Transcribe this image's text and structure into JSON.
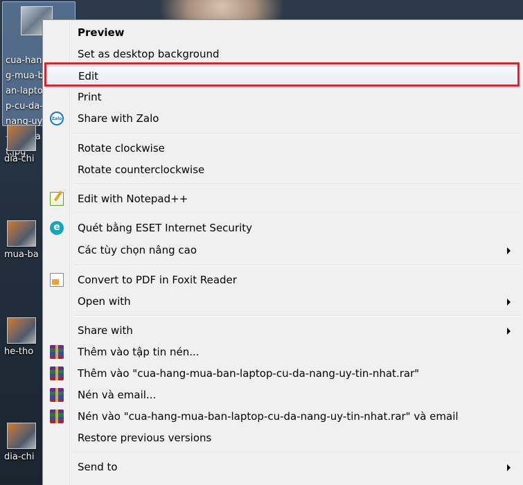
{
  "desktop": {
    "selected_icon_label": "cua-hang-mua-ban-laptop-cu-da-nang-uy-tin-nhat.jpg",
    "icons": [
      {
        "label": "dia-chi"
      },
      {
        "label": "mua-ba"
      },
      {
        "label": "he-tho"
      },
      {
        "label": "dia-chi"
      }
    ]
  },
  "menu": {
    "items": [
      {
        "label": "Preview",
        "bold": true
      },
      {
        "label": "Set as desktop background"
      },
      {
        "label": "Edit",
        "highlighted": true
      },
      {
        "label": "Print"
      },
      {
        "label": "Share with Zalo",
        "icon": "zalo-icon"
      },
      {
        "label": "Rotate clockwise"
      },
      {
        "label": "Rotate counterclockwise"
      },
      {
        "label": "Edit with Notepad++",
        "icon": "notepadpp-icon"
      },
      {
        "label": "Quét bằng ESET Internet Security",
        "icon": "eset-icon"
      },
      {
        "label": "Các tùy chọn nâng cao",
        "submenu": true
      },
      {
        "label": "Convert to PDF in Foxit Reader",
        "icon": "foxit-pdf-icon"
      },
      {
        "label": "Open with",
        "submenu": true
      },
      {
        "label": "Share with",
        "submenu": true
      },
      {
        "label": "Thêm vào tập tin nén...",
        "icon": "winrar-icon"
      },
      {
        "label": "Thêm vào \"cua-hang-mua-ban-laptop-cu-da-nang-uy-tin-nhat.rar\"",
        "icon": "winrar-icon"
      },
      {
        "label": "Nén và email...",
        "icon": "winrar-icon"
      },
      {
        "label": "Nén vào \"cua-hang-mua-ban-laptop-cu-da-nang-uy-tin-nhat.rar\" và email",
        "icon": "winrar-icon"
      },
      {
        "label": "Restore previous versions"
      },
      {
        "label": "Send to",
        "submenu": true
      }
    ]
  },
  "colors": {
    "highlight_border": "#d9232d",
    "menu_bg": "#f0f0f0"
  }
}
